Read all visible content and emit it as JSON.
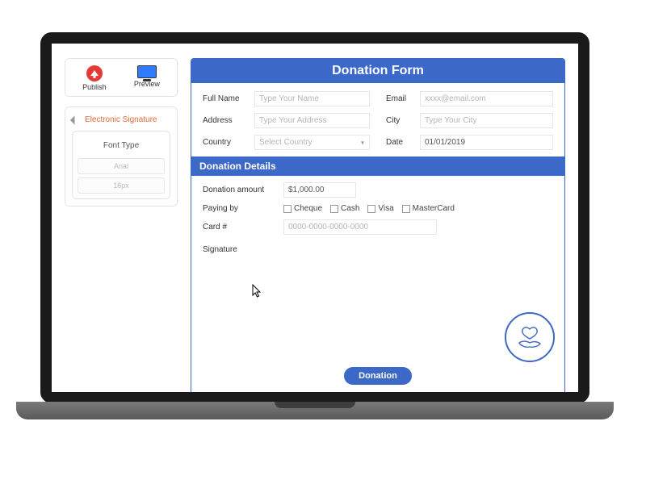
{
  "sidebar": {
    "publish_label": "Publish",
    "preview_label": "Preview",
    "signature_title": "Electronic Signature",
    "font_type_label": "Font Type",
    "font_name": "Arial",
    "font_size": "16px"
  },
  "form": {
    "title": "Donation Form",
    "full_name_label": "Full Name",
    "full_name_placeholder": "Type Your Name",
    "email_label": "Email",
    "email_placeholder": "xxxx@email.com",
    "address_label": "Address",
    "address_placeholder": "Type Your Address",
    "city_label": "City",
    "city_placeholder": "Type Your City",
    "country_label": "Country",
    "country_placeholder": "Select Country",
    "date_label": "Date",
    "date_value": "01/01/2019",
    "details_title": "Donation Details",
    "amount_label": "Donation amount",
    "amount_value": "$1,000.00",
    "paying_by_label": "Paying by",
    "pay_options": {
      "cheque": "Cheque",
      "cash": "Cash",
      "visa": "Visa",
      "mastercard": "MasterCard"
    },
    "card_label": "Card #",
    "card_placeholder": "0000-0000-0000-0000",
    "signature_label": "Signature",
    "submit_label": "Donation"
  },
  "colors": {
    "brand": "#3c68c7",
    "accent_orange": "#e06a3c",
    "danger": "#e53935"
  }
}
